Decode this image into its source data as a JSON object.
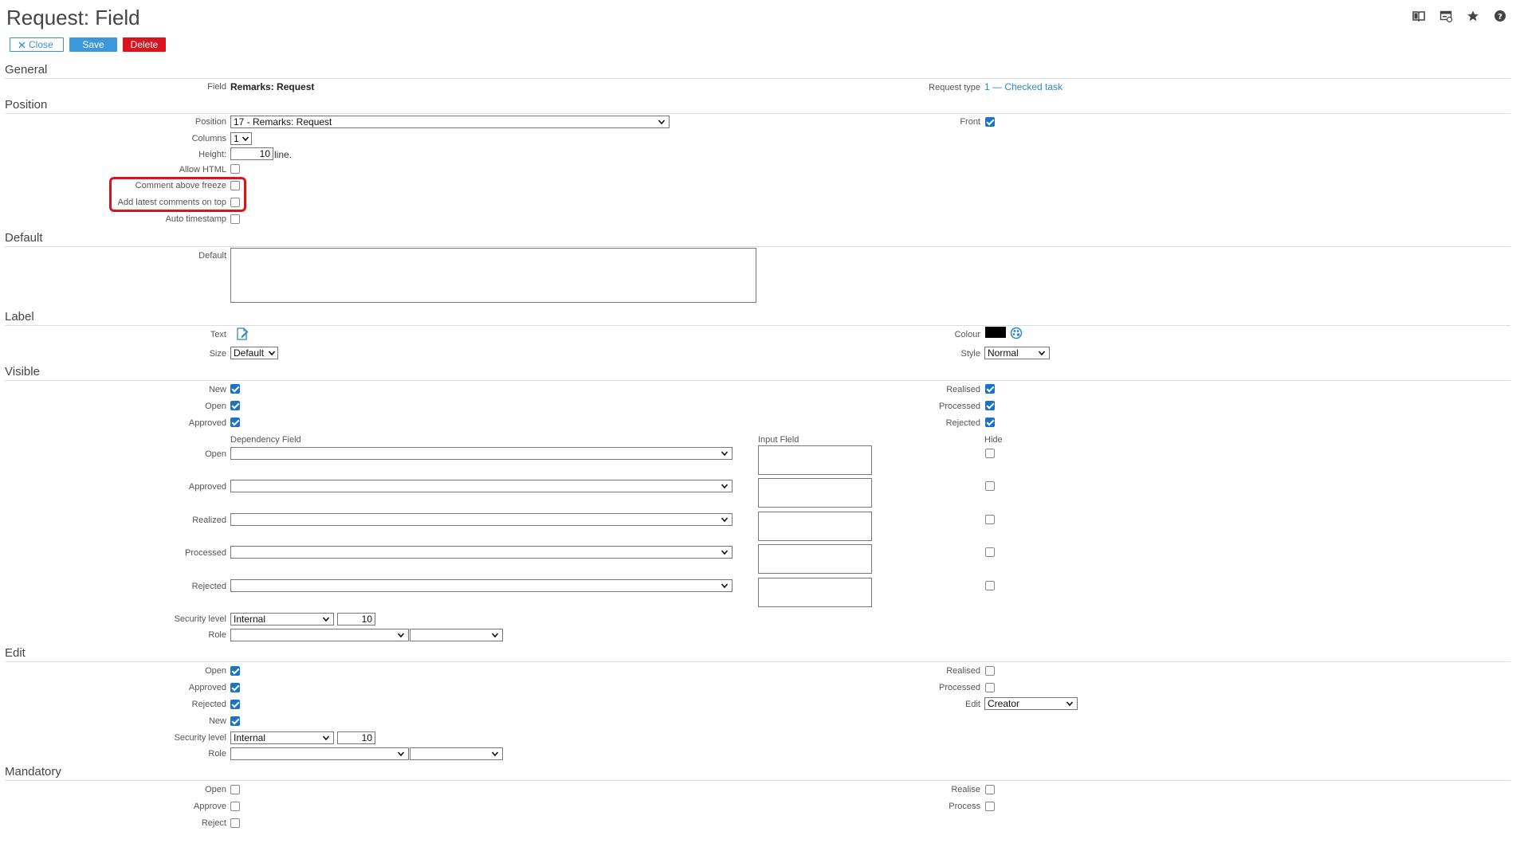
{
  "header": {
    "title": "Request: Field",
    "icons": [
      "book-icon",
      "form-window-icon",
      "star-icon",
      "help-icon"
    ]
  },
  "toolbar": {
    "close_label": "Close",
    "save_label": "Save",
    "delete_label": "Delete"
  },
  "colors": {
    "accent": "#3a99dc",
    "danger": "#d9141e",
    "link": "#2f86c8",
    "checkbox": "#1a73c8"
  },
  "general": {
    "title": "General",
    "field_label": "Field",
    "field_value": "Remarks: Request",
    "request_type_label": "Request type",
    "request_type_value": "1 — Checked task"
  },
  "position": {
    "title": "Position",
    "position_label": "Position",
    "position_value": "17 - Remarks: Request",
    "front_label": "Front",
    "front_checked": true,
    "columns_label": "Columns",
    "columns_value": "1",
    "height_label": "Height:",
    "height_value": "10",
    "height_unit": "line.",
    "allow_html_label": "Allow HTML",
    "comment_above_freeze_label": "Comment above freeze",
    "add_latest_label": "Add latest comments on top",
    "auto_timestamp_label": "Auto timestamp"
  },
  "default_section": {
    "title": "Default",
    "default_label": "Default",
    "default_value": ""
  },
  "label_section": {
    "title": "Label",
    "text_label": "Text",
    "size_label": "Size",
    "size_value": "Default",
    "colour_label": "Colour",
    "colour_value": "#000000",
    "style_label": "Style",
    "style_value": "Normal"
  },
  "visible": {
    "title": "Visible",
    "new_label": "New",
    "open_label": "Open",
    "approved_label": "Approved",
    "realised_label": "Realised",
    "processed_label": "Processed",
    "rejected_label": "Rejected",
    "dep_header": "Dependency Field",
    "input_header": "Input Field",
    "hide_header": "Hide",
    "dep_rows": [
      {
        "label": "Open"
      },
      {
        "label": "Approved"
      },
      {
        "label": "Realized"
      },
      {
        "label": "Processed"
      },
      {
        "label": "Rejected"
      }
    ],
    "security_label": "Security level",
    "security_value": "Internal",
    "security_num": "10",
    "role_label": "Role"
  },
  "edit": {
    "title": "Edit",
    "open_label": "Open",
    "approved_label": "Approved",
    "rejected_label": "Rejected",
    "new_label": "New",
    "realised_label": "Realised",
    "processed_label": "Processed",
    "edit_label": "Edit",
    "edit_value": "Creator",
    "security_label": "Security level",
    "security_value": "Internal",
    "security_num": "10",
    "role_label": "Role"
  },
  "mandatory": {
    "title": "Mandatory",
    "open_label": "Open",
    "approve_label": "Approve",
    "reject_label": "Reject",
    "realise_label": "Realise",
    "process_label": "Process"
  }
}
